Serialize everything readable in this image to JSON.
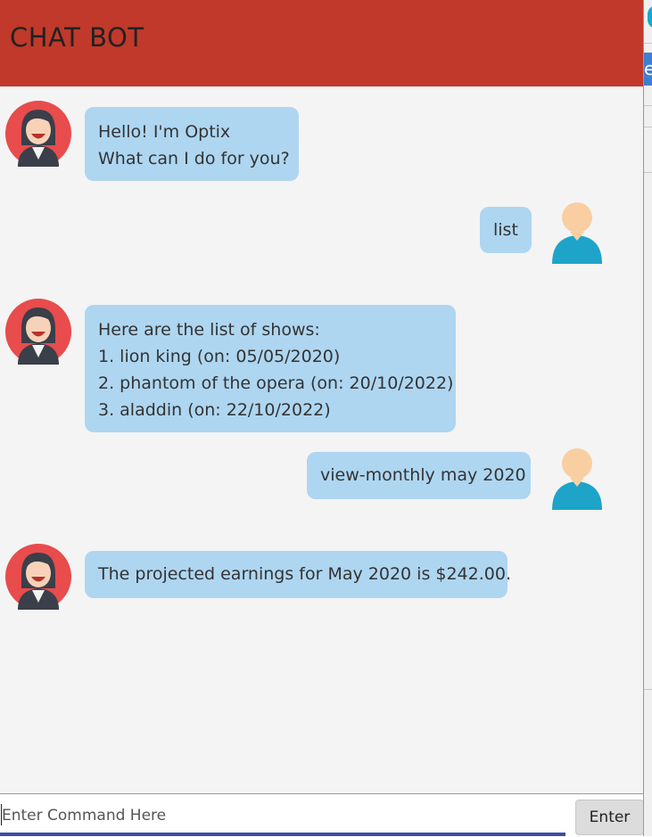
{
  "header": {
    "title": "CHAT BOT"
  },
  "side_strip": {
    "partial_label": "e"
  },
  "messages": [
    {
      "sender": "bot",
      "lines": [
        "Hello! I'm Optix",
        "What can I do for you?"
      ]
    },
    {
      "sender": "user",
      "lines": [
        "list"
      ]
    },
    {
      "sender": "bot",
      "lines": [
        "Here are the list of shows:",
        "1. lion king (on: 05/05/2020)",
        "2. phantom of the opera (on: 20/10/2022)",
        "3. aladdin (on: 22/10/2022)"
      ]
    },
    {
      "sender": "user",
      "lines": [
        "view-monthly may 2020"
      ]
    },
    {
      "sender": "bot",
      "lines": [
        "The projected earnings for May 2020 is $242.00."
      ]
    }
  ],
  "input": {
    "placeholder": "Enter Command Here",
    "value": ""
  },
  "enter_button": {
    "label": "Enter"
  },
  "colors": {
    "header": "#c0392b",
    "bubble": "#aed6f1",
    "background": "#f4f4f4",
    "user_avatar": "#1da4c8",
    "bot_avatar": "#e84c4c"
  },
  "icons": {
    "bot_avatar": "bot-avatar-icon",
    "user_avatar": "user-avatar-icon"
  }
}
